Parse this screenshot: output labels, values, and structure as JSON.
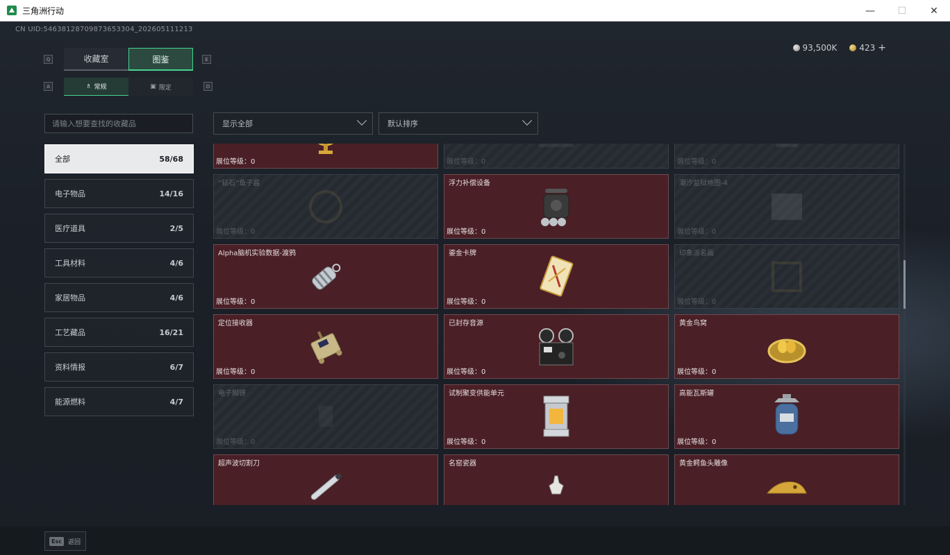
{
  "window": {
    "title": "三角洲行动",
    "minimize": "—",
    "maximize": "☐",
    "close": "✕"
  },
  "uid": "CN UID:5463812870987365330​4_202605111213",
  "currency": {
    "silver": "93,500K",
    "gold": "423",
    "add": "+"
  },
  "keyhints": {
    "q": "Q",
    "e": "E",
    "a": "A",
    "d": "D"
  },
  "tabs": [
    {
      "label": "收藏室"
    },
    {
      "label": "图鉴"
    }
  ],
  "subtabs": [
    {
      "label": "常规",
      "icon": "♗"
    },
    {
      "label": "限定",
      "icon": "▣"
    }
  ],
  "search": {
    "placeholder": "请输入想要查找的收藏品"
  },
  "categories": [
    {
      "label": "全部",
      "count": "58/68"
    },
    {
      "label": "电子物品",
      "count": "14/16"
    },
    {
      "label": "医疗道具",
      "count": "2/5"
    },
    {
      "label": "工具材料",
      "count": "4/6"
    },
    {
      "label": "家居物品",
      "count": "4/6"
    },
    {
      "label": "工艺藏品",
      "count": "16/21"
    },
    {
      "label": "资料情报",
      "count": "6/7"
    },
    {
      "label": "能源燃料",
      "count": "4/7"
    }
  ],
  "filters": {
    "show": "显示全部",
    "sort": "默认排序"
  },
  "level_label": "展位等级：0",
  "items": [
    {
      "name": "",
      "level": "展位等级：0",
      "locked": false,
      "icon": "armillary-sphere-icon"
    },
    {
      "name": "",
      "level": "展位等级：0",
      "locked": true,
      "icon": "chessboard-icon"
    },
    {
      "name": "",
      "level": "展位等级：0",
      "locked": true,
      "icon": "robot-icon"
    },
    {
      "name": "“钻石”鱼子酱",
      "level": "展位等级：0",
      "locked": true,
      "icon": "caviar-icon"
    },
    {
      "name": "浮力补偿设备",
      "level": "展位等级：0",
      "locked": false,
      "icon": "bcd-vest-icon"
    },
    {
      "name": "潮汐监狱地图-4",
      "level": "展位等级：0",
      "locked": true,
      "icon": "map-icon"
    },
    {
      "name": "Alpha脑机实验数据-渡鸦",
      "level": "展位等级：0",
      "locked": false,
      "icon": "data-canister-icon"
    },
    {
      "name": "鎏金卡牌",
      "level": "展位等级：0",
      "locked": false,
      "icon": "gilded-card-icon"
    },
    {
      "name": "印象派名画",
      "level": "展位等级：0",
      "locked": true,
      "icon": "painting-icon"
    },
    {
      "name": "定位接收器",
      "level": "展位等级：0",
      "locked": false,
      "icon": "gps-receiver-icon"
    },
    {
      "name": "已封存音源",
      "level": "展位等级：0",
      "locked": false,
      "icon": "reel-recorder-icon"
    },
    {
      "name": "黄金鸟窝",
      "level": "展位等级：0",
      "locked": false,
      "icon": "golden-nest-icon"
    },
    {
      "name": "电子脚镣",
      "level": "展位等级：0",
      "locked": true,
      "icon": "ankle-monitor-icon"
    },
    {
      "name": "试制聚变供能单元",
      "level": "展位等级：0",
      "locked": false,
      "icon": "fusion-cell-icon"
    },
    {
      "name": "高能瓦斯罐",
      "level": "展位等级：0",
      "locked": false,
      "icon": "gas-canister-icon"
    },
    {
      "name": "超声波切割刀",
      "level": "",
      "locked": false,
      "icon": "ultrasonic-knife-icon"
    },
    {
      "name": "名窑瓷器",
      "level": "",
      "locked": false,
      "icon": "porcelain-icon"
    },
    {
      "name": "黄金鳄鱼头雕像",
      "level": "",
      "locked": false,
      "icon": "gold-crocodile-icon"
    }
  ],
  "esc": {
    "key": "Esc",
    "label": "返回"
  }
}
